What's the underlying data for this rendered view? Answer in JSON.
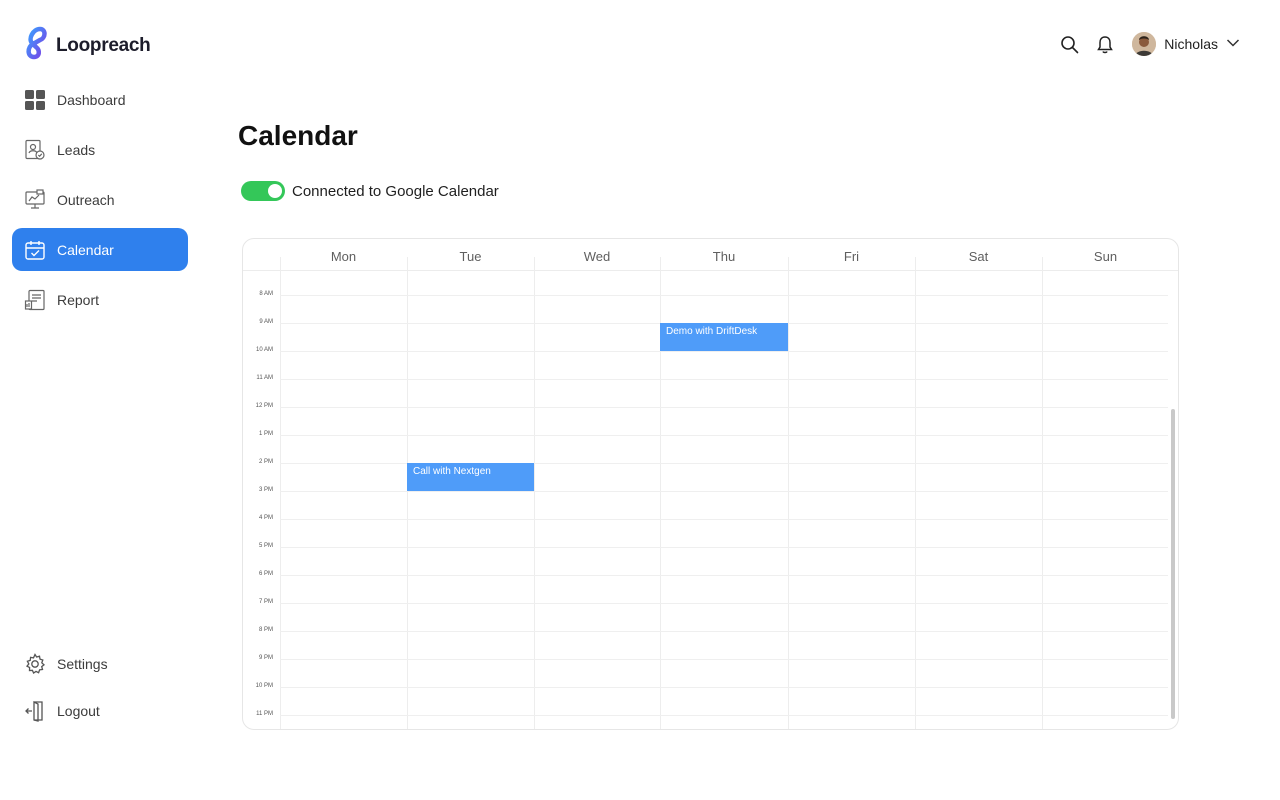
{
  "app": {
    "name": "Loopreach",
    "brand_color": "#2f80ed"
  },
  "sidebar": {
    "items": [
      {
        "label": "Dashboard",
        "icon": "dashboard-icon"
      },
      {
        "label": "Leads",
        "icon": "leads-icon"
      },
      {
        "label": "Outreach",
        "icon": "outreach-icon"
      },
      {
        "label": "Calendar",
        "icon": "calendar-icon",
        "active": true
      },
      {
        "label": "Report",
        "icon": "report-icon"
      }
    ],
    "bottom_items": [
      {
        "label": "Settings",
        "icon": "gear-icon"
      },
      {
        "label": "Logout",
        "icon": "logout-icon"
      }
    ]
  },
  "header": {
    "user_name": "Nicholas",
    "icons": [
      "search-icon",
      "bell-icon",
      "chevron-down-icon"
    ]
  },
  "page": {
    "title": "Calendar",
    "google_toggle": {
      "label": "Connected to Google Calendar",
      "on": true,
      "color": "#34c759"
    }
  },
  "calendar": {
    "days": [
      "Mon",
      "Tue",
      "Wed",
      "Thu",
      "Fri",
      "Sat",
      "Sun"
    ],
    "times": [
      "8 AM",
      "9 AM",
      "10 AM",
      "11 AM",
      "12 PM",
      "1 PM",
      "2 PM",
      "3 PM",
      "4 PM",
      "5 PM",
      "6 PM",
      "7 PM",
      "8 PM",
      "9 PM",
      "10 PM",
      "11 PM"
    ],
    "events": [
      {
        "title": "Demo with DriftDesk",
        "day": "Thu",
        "start": "9 AM",
        "end": "10 AM"
      },
      {
        "title": "Call with Nextgen",
        "day": "Tue",
        "start": "2 PM",
        "end": "3 PM"
      }
    ],
    "event_color": "#4f9cf9"
  }
}
